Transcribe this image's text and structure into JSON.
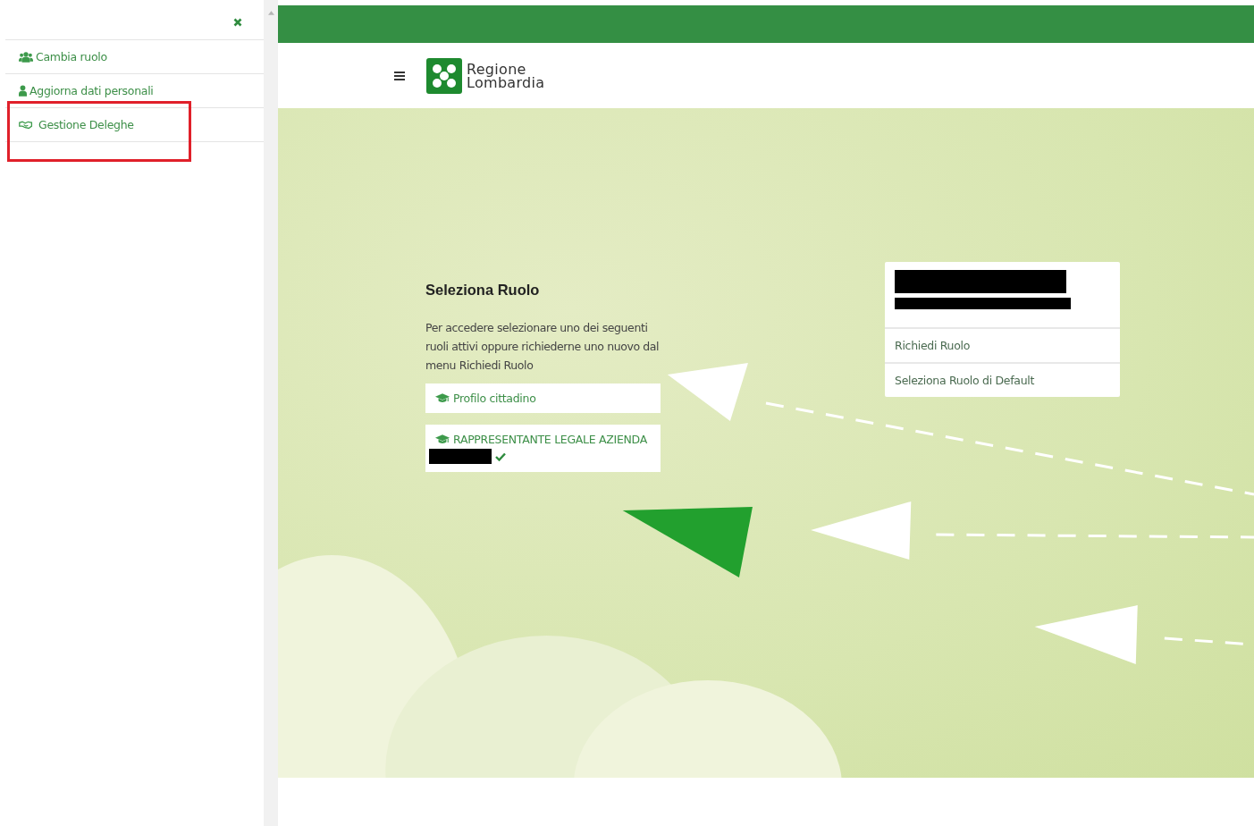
{
  "sidebar": {
    "items": [
      {
        "label": "Cambia ruolo",
        "kind": "users",
        "highlighted": false
      },
      {
        "label": "Aggiorna dati personali",
        "kind": "user",
        "highlighted": false
      },
      {
        "label": "Gestione Deleghe",
        "kind": "handshake",
        "highlighted": true
      }
    ]
  },
  "header": {
    "logo_text": [
      "Regione",
      "Lombardia"
    ]
  },
  "roles": {
    "title": "Seleziona Ruolo",
    "description": "Per accedere selezionare uno dei seguenti ruoli attivi oppure richiederne uno nuovo dal menu Richiedi Ruolo",
    "items": [
      {
        "label": "Profilo cittadino",
        "redacted": false,
        "checked": false
      },
      {
        "label": "RAPPRESENTANTE LEGALE AZIENDA",
        "redacted": true,
        "checked": true
      }
    ]
  },
  "user_menu": {
    "items": [
      "Richiedi Ruolo",
      "Seleziona Ruolo di Default"
    ]
  }
}
